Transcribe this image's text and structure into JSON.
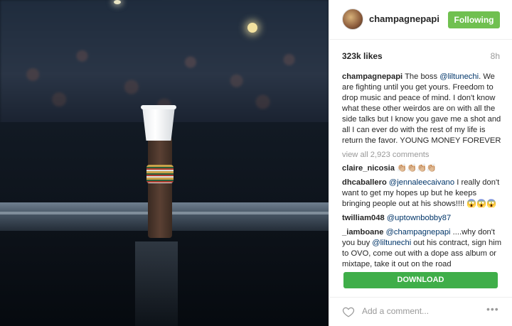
{
  "post": {
    "username": "champagnepapi",
    "follow_label": "Following",
    "likes": "323k likes",
    "time": "8h",
    "caption": {
      "user": "champagnepapi",
      "text_1": " The boss ",
      "mention": "@liltunechi",
      "text_2": ". We are fighting until you get yours. Freedom to drop music and peace of mind. I don't know what these other weirdos are on with all the side talks but I know you gave me a shot and all I can ever do with the rest of my life is return the favor. YOUNG MONEY FOREVER"
    },
    "view_all": "view all 2,923 comments",
    "comments": [
      {
        "user": "claire_nicosia",
        "text": " 👏🏼👏🏼👏🏼👏🏼"
      },
      {
        "user": "dhcaballero",
        "mention": "@jennaleecaivano",
        "text": " I really don't want to get my hopes up but he keeps bringing people out at his shows!!!! 😱😱😱"
      },
      {
        "user": "twilliam048",
        "mention": "@uptownbobby87",
        "text": ""
      },
      {
        "user": "_iamboane",
        "mention": "@champagnepapi",
        "text": " ....why don't you buy ",
        "mention_2": "@liltunechi",
        "text_2": " out his contract, sign him to OVO, come out with a dope ass album or mixtape, take it out on the road"
      }
    ],
    "download_label": "DOWNLOAD",
    "add_comment_placeholder": "Add a comment...",
    "more_label": "•••"
  },
  "icons": {
    "heart": "heart-icon",
    "more": "more-options-icon"
  },
  "colors": {
    "follow_button": "#70c050",
    "download_button": "#3fae49",
    "mention": "#003569"
  }
}
